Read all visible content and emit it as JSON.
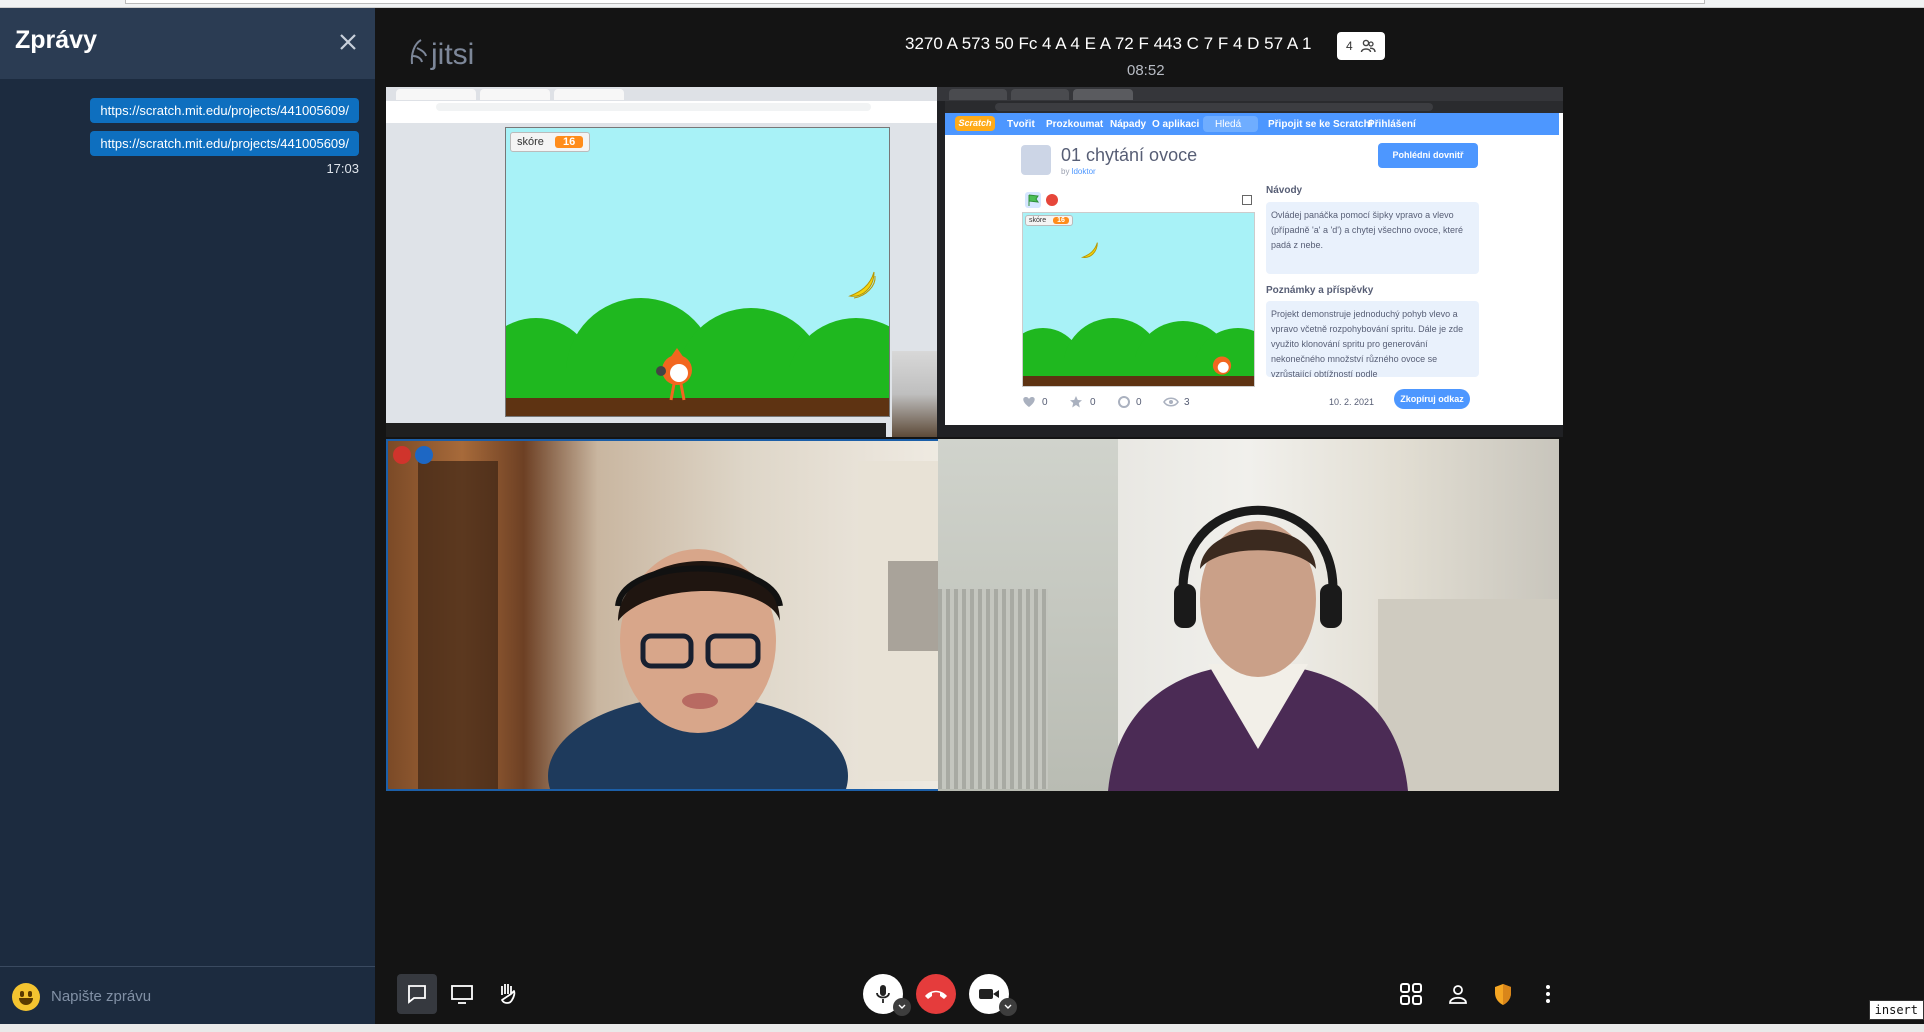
{
  "chat": {
    "title": "Zprávy",
    "messages": [
      "https://scratch.mit.edu/projects/441005609/",
      "https://scratch.mit.edu/projects/441005609/"
    ],
    "time": "17:03",
    "input_placeholder": "Napište zprávu"
  },
  "header": {
    "logo": "jitsi",
    "room_name": "3270 A 573 50 Fc 4 A 4 E A 72 F 443 C 7 F 4 D 57 A 1",
    "participant_count": "4",
    "timer": "08:52"
  },
  "screen1": {
    "score_label": "skóre",
    "score_value": "16"
  },
  "screen2": {
    "nav": [
      "Tvořit",
      "Prozkoumat",
      "Nápady",
      "O aplikaci",
      "Hledá",
      "Připojit se ke Scratchi",
      "Přihlášení"
    ],
    "title": "01 chytání ovoce",
    "by": "by",
    "author": "ldoktor",
    "see_inside": "Pohlédni dovnitř",
    "score_label": "skóre",
    "score_value": "16",
    "instructions_heading": "Návody",
    "instructions_text": "Ovládej panáčka pomocí šipky vpravo a vlevo (případně 'a' a 'd') a chytej všechno ovoce, které padá z nebe.",
    "notes_heading": "Poznámky a příspěvky",
    "notes_text": "Projekt demonstruje jednoduchý pohyb vlevo a vpravo včetně rozpohybování spritu. Dále je zde využito klonování spritu pro generování nekonečného množství různého ovoce se vzrůstající obtížností podle",
    "stats": [
      "0",
      "0",
      "0",
      "3"
    ],
    "date": "10. 2. 2021",
    "share": "Zkopíruj odkaz"
  },
  "status": {
    "insert_label": "insert"
  },
  "colors": {
    "accent": "#0e6fbf",
    "hangup": "#e53c3c",
    "shield": "#f5a623"
  }
}
